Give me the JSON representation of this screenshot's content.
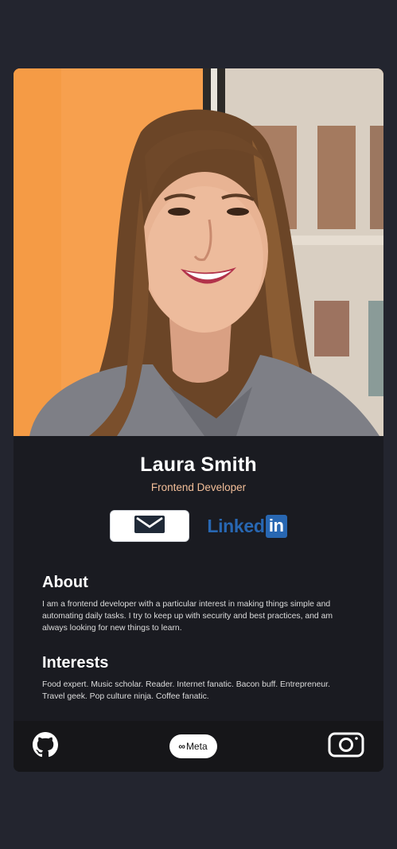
{
  "profile": {
    "name": "Laura Smith",
    "title": "Frontend Developer"
  },
  "buttons": {
    "email_icon": "envelope-icon",
    "linkedin_word": "Linked",
    "linkedin_box": "in"
  },
  "about": {
    "heading": "About",
    "text": "I am a frontend developer with a particular interest in making things simple and automating daily tasks. I try to keep up with security and best practices, and am always looking for new things to learn."
  },
  "interests": {
    "heading": "Interests",
    "text": "Food expert. Music scholar. Reader. Internet fanatic. Bacon buff. Entrepreneur. Travel geek. Pop culture ninja. Coffee fanatic."
  },
  "footer": {
    "github_icon": "github-icon",
    "meta_symbol": "∞",
    "meta_label": "Meta",
    "instagram_icon": "instagram-icon"
  },
  "colors": {
    "page_bg": "#23252f",
    "card_bg": "#1a1b21",
    "footer_bg": "#161619",
    "accent_title": "#f3bf99",
    "linkedin_blue": "#2867b2"
  }
}
